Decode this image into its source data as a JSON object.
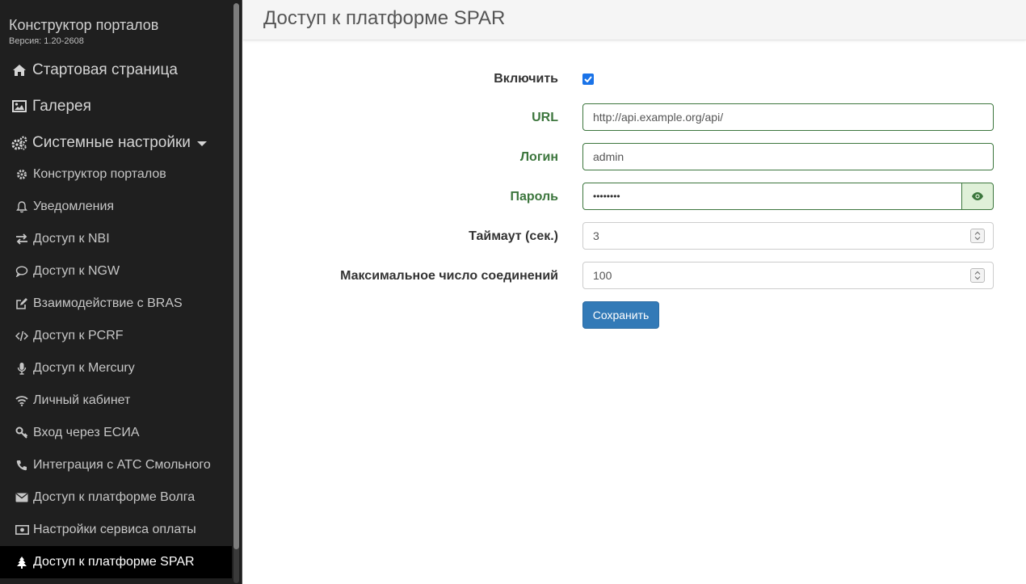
{
  "sidebar": {
    "brand": "Конструктор порталов",
    "version": "Версия: 1.20-2608",
    "top_items": [
      {
        "label": "Стартовая страница",
        "icon": "home-icon"
      },
      {
        "label": "Галерея",
        "icon": "image-icon"
      },
      {
        "label": "Системные настройки",
        "icon": "cogs-icon"
      }
    ],
    "sub_items": [
      {
        "label": "Конструктор порталов",
        "icon": "gear-icon"
      },
      {
        "label": "Уведомления",
        "icon": "bell-icon"
      },
      {
        "label": "Доступ к NBI",
        "icon": "transfer-icon"
      },
      {
        "label": "Доступ к NGW",
        "icon": "comment-icon"
      },
      {
        "label": "Взаимодействие с BRAS",
        "icon": "edit-icon"
      },
      {
        "label": "Доступ к PCRF",
        "icon": "code-icon"
      },
      {
        "label": "Доступ к Mercury",
        "icon": "microphone-icon"
      },
      {
        "label": "Личный кабинет",
        "icon": "wifi-icon"
      },
      {
        "label": "Вход через ЕСИА",
        "icon": "key-icon"
      },
      {
        "label": "Интеграция с АТС Смольного",
        "icon": "phone-icon"
      },
      {
        "label": "Доступ к платформе Волга",
        "icon": "envelope-icon"
      },
      {
        "label": "Настройки сервиса оплаты",
        "icon": "money-icon"
      },
      {
        "label": "Доступ к платформе SPAR",
        "icon": "tree-icon"
      }
    ]
  },
  "header": {
    "title": "Доступ к платформе SPAR"
  },
  "form": {
    "enable": {
      "label": "Включить",
      "checked": true
    },
    "url": {
      "label": "URL",
      "value": "http://api.example.org/api/"
    },
    "login": {
      "label": "Логин",
      "value": "admin"
    },
    "password": {
      "label": "Пароль",
      "value": "••••••••"
    },
    "timeout": {
      "label": "Таймаут (сек.)",
      "value": "3"
    },
    "max_connections": {
      "label": "Максимальное число соединений",
      "value": "100"
    },
    "save_label": "Сохранить"
  },
  "colors": {
    "sidebar_bg": "#1f1f1f",
    "active_bg": "#000000",
    "success": "#3c763d",
    "primary": "#337ab7"
  }
}
